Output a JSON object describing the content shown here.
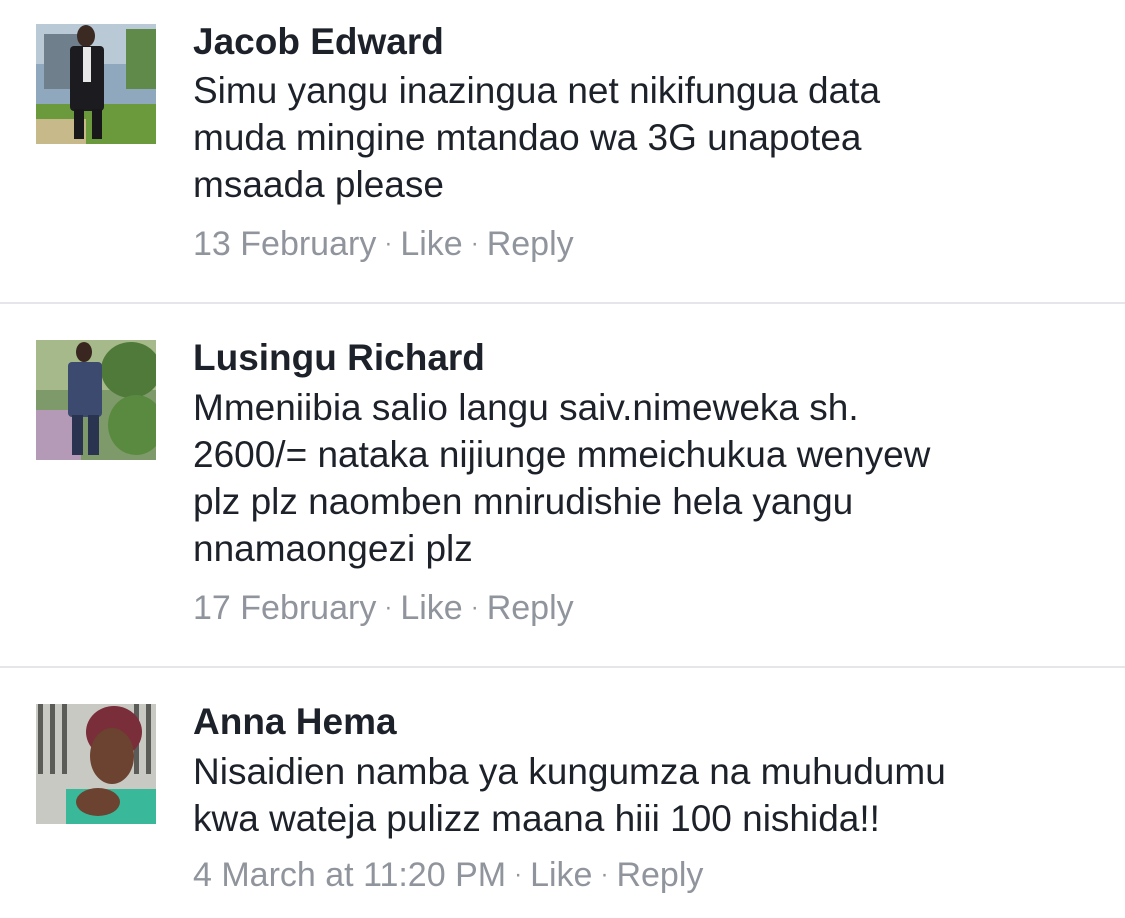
{
  "comments": [
    {
      "author": "Jacob Edward",
      "lines": [
        "Simu yangu inazingua net nikifungua data",
        "muda mingine mtandao wa 3G unapotea",
        "msaada please"
      ],
      "date": "13 February",
      "like_label": "Like",
      "reply_label": "Reply",
      "separator": "·"
    },
    {
      "author": "Lusingu Richard",
      "lines": [
        "Mmeniibia  salio langu saiv.nimeweka sh.",
        "2600/= nataka nijiunge mmeichukua wenyew",
        "plz plz naomben mnirudishie hela yangu",
        "nnamaongezi plz"
      ],
      "date": "17 February",
      "like_label": "Like",
      "reply_label": "Reply",
      "separator": "·"
    },
    {
      "author": "Anna Hema",
      "lines": [
        "Nisaidien namba ya kungumza na muhudumu",
        "kwa wateja pulizz maana hiii 100 nishida!!"
      ],
      "date": "4 March at 11:20 PM",
      "like_label": "Like",
      "reply_label": "Reply",
      "separator": "·"
    }
  ],
  "colors": {
    "text": "#1d2129",
    "meta": "#90949c",
    "divider": "#e5e6e9"
  }
}
